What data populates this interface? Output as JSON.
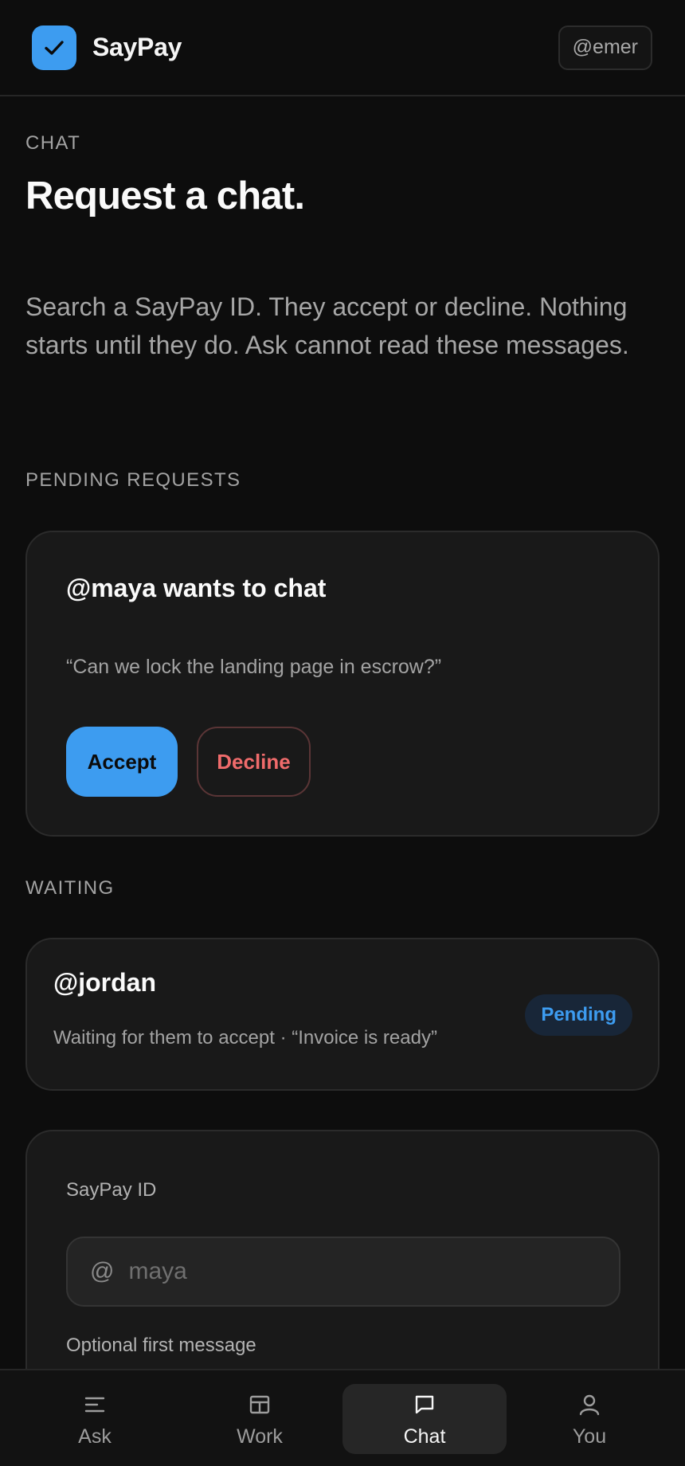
{
  "header": {
    "brand_name": "SayPay",
    "logo_icon": "check-icon",
    "user_handle": "@emer"
  },
  "main": {
    "eyebrow": "CHAT",
    "title": "Request a chat.",
    "intro": "Search a SayPay ID. They accept or decline. Nothing starts until they do. Ask cannot read these messages.",
    "pending_section": "PENDING REQUESTS",
    "pending_request": {
      "title": "@maya wants to chat",
      "message": "“Can we lock the landing page in escrow?”",
      "accept_label": "Accept",
      "decline_label": "Decline"
    },
    "waiting_section": "WAITING",
    "waiting_item": {
      "name": "@jordan",
      "subtitle": "Waiting for them to accept · “Invoice is ready”",
      "status": "Pending"
    },
    "form": {
      "id_label": "SayPay ID",
      "at_symbol": "@",
      "id_placeholder": "maya",
      "message_label": "Optional first message"
    }
  },
  "nav": {
    "items": [
      {
        "label": "Ask",
        "icon": "menu-lines-icon"
      },
      {
        "label": "Work",
        "icon": "layout-icon"
      },
      {
        "label": "Chat",
        "icon": "chat-bubble-icon"
      },
      {
        "label": "You",
        "icon": "user-icon"
      }
    ],
    "active": "Chat"
  },
  "colors": {
    "background": "#0d0d0d",
    "card": "#191919",
    "accent": "#3d9cf0",
    "danger": "#ef6b6b",
    "badge_bg": "#182638"
  }
}
